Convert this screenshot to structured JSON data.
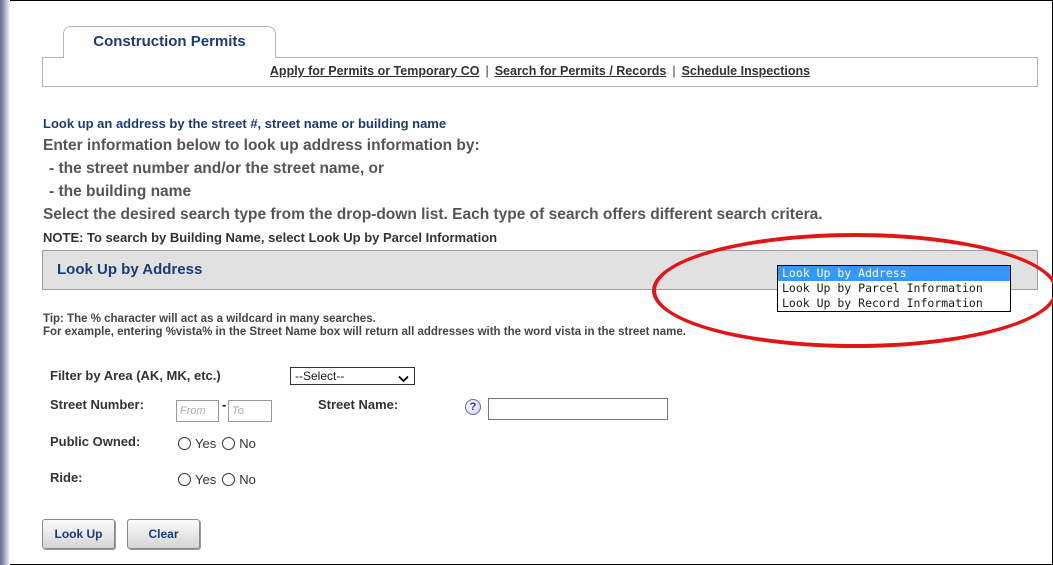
{
  "tab": {
    "label": "Construction Permits"
  },
  "nav": {
    "links": [
      "Apply for Permits or Temporary CO",
      "Search for Permits / Records",
      "Schedule Inspections"
    ],
    "separator": "|"
  },
  "heading": "Look up an address by the street #, street name or building name",
  "instructions": {
    "intro": "Enter information below to look up address information by:",
    "bullet1": "- the street number and/or the street name, or",
    "bullet2": "- the building name",
    "select_text": "Select the desired search type from the drop-down list. Each type of search offers different search critera."
  },
  "note": "NOTE: To search by Building Name, select Look Up by Parcel Information",
  "lookup": {
    "title": "Look Up by Address",
    "options": [
      "Look Up by Address",
      "Look Up by Parcel Information",
      "Look Up by Record Information"
    ],
    "selected": "Look Up by Address"
  },
  "tip": {
    "line1": "Tip: The % character will act as a wildcard in many searches.",
    "line2": "For example, entering %vista% in the Street Name box will return all addresses with the word vista in the street name."
  },
  "form": {
    "filter_label": "Filter by Area (AK, MK, etc.)",
    "filter_value": "--Select--",
    "street_number_label": "Street Number:",
    "from_placeholder": "From",
    "to_placeholder": "To",
    "dash": "-",
    "street_name_label": "Street Name:",
    "help_glyph": "?",
    "public_owned_label": "Public Owned:",
    "ride_label": "Ride:",
    "yes": "Yes",
    "no": "No"
  },
  "buttons": {
    "lookup": "Look Up",
    "clear": "Clear"
  },
  "colors": {
    "accent": "#1c3b72",
    "highlight": "#3399ff",
    "annotation": "#e31414"
  }
}
